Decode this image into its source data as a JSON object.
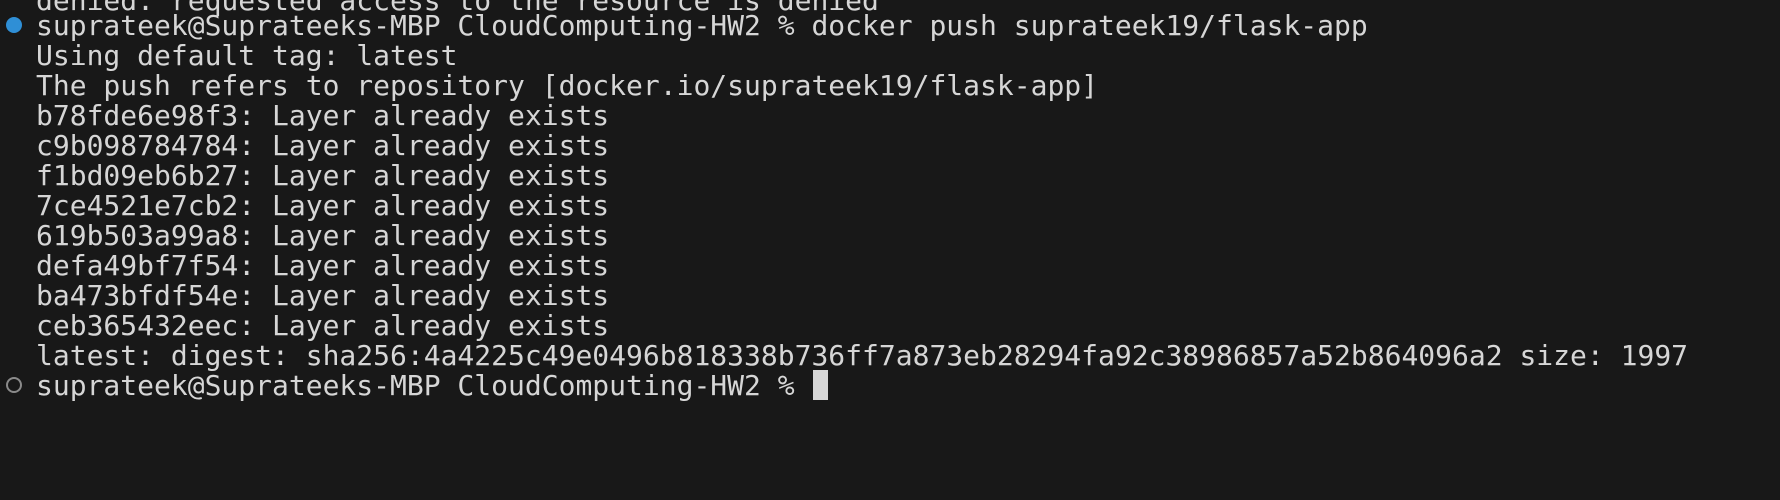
{
  "terminal": {
    "partial_top_line": "denied: requested access to the resource is denied",
    "command_prompt": "suprateek@Suprateeks-MBP CloudComputing-HW2 % docker push suprateek19/flask-app",
    "output": [
      "Using default tag: latest",
      "The push refers to repository [docker.io/suprateek19/flask-app]",
      "b78fde6e98f3: Layer already exists",
      "c9b098784784: Layer already exists",
      "f1bd09eb6b27: Layer already exists",
      "7ce4521e7cb2: Layer already exists",
      "619b503a99a8: Layer already exists",
      "defa49bf7f54: Layer already exists",
      "ba473bfdf54e: Layer already exists",
      "ceb365432eec: Layer already exists",
      "latest: digest: sha256:4a4225c49e0496b818338b736ff7a873eb28294fa92c38986857a52b864096a2 size: 1997"
    ],
    "final_prompt": "suprateek@Suprateeks-MBP CloudComputing-HW2 % "
  },
  "colors": {
    "background": "#181818",
    "text": "#d6d6d6",
    "success_dot": "#2f8fd6",
    "idle_dot": "#8a8a8a"
  },
  "icons": {
    "command_status": "command-status-dot-icon",
    "prompt_status": "prompt-status-dot-icon"
  }
}
